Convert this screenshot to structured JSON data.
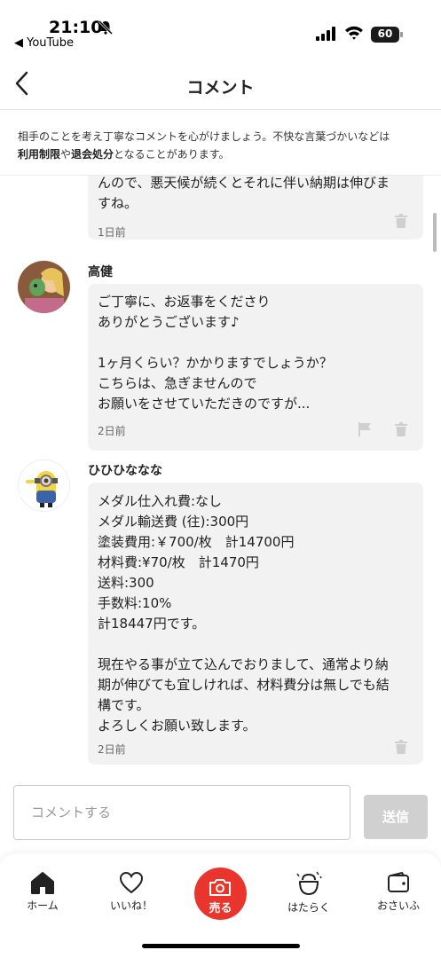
{
  "status_bar": {
    "time": "21:10",
    "back_app": "◀ YouTube",
    "battery": "60"
  },
  "header": {
    "title": "コメント"
  },
  "notice": {
    "part1": "相手のことを考え丁寧なコメントを心がけましょう。不快な言葉づかいなどは",
    "bold1": "利用制限",
    "part2": "や",
    "bold2": "退会処分",
    "part3": "となることがあります。"
  },
  "comments": [
    {
      "author": "",
      "text": "んので、悪天候が続くとそれに伴い納期は伸びま\nすね。",
      "time": "1日前"
    },
    {
      "author": "高健",
      "text": "ご丁寧に、お返事をくださり\nありがとうございます♪\n\n1ヶ月くらい？かかりますでしょうか？\nこちらは、急ぎませんので\nお願いをさせていただきのですが...",
      "time": "2日前"
    },
    {
      "author": "ひひひななな",
      "text": "メダル仕入れ費:なし\nメダル輸送費 (往):300円\n塗装費用:￥700/枚　計14700円\n材料費:¥70/枚　計1470円\n送料:300\n手数料:10%\n計18447円です。\n\n現在やる事が立て込んでおりまして、通常より納\n期が伸びても宜しければ、材料費分は無しでも結\n構です。\nよろしくお願い致します。",
      "time": "2日前"
    }
  ],
  "input": {
    "placeholder": "コメントする",
    "send_label": "送信"
  },
  "tabbar": {
    "home": "ホーム",
    "likes": "いいね！",
    "sell": "売る",
    "work": "はたらく",
    "wallet": "おさいふ"
  },
  "colors": {
    "accent": "#ea352d",
    "bubble": "#f2f2f2",
    "send_disabled": "#d0d0d0"
  }
}
